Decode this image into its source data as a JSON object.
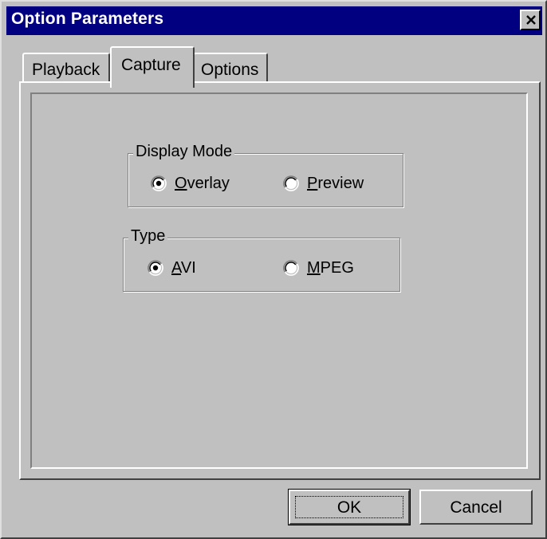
{
  "window": {
    "title": "Option Parameters"
  },
  "tabs": [
    {
      "label": "Playback",
      "selected": false
    },
    {
      "label": "Capture",
      "selected": true
    },
    {
      "label": "Options",
      "selected": false
    }
  ],
  "display_mode": {
    "legend": "Display Mode",
    "options": [
      {
        "mnemonic": "O",
        "rest": "verlay",
        "checked": true
      },
      {
        "mnemonic": "P",
        "rest": "review",
        "checked": false
      }
    ]
  },
  "type": {
    "legend": "Type",
    "options": [
      {
        "mnemonic": "A",
        "rest": "VI",
        "checked": true
      },
      {
        "mnemonic": "M",
        "rest": "PEG",
        "checked": false
      }
    ]
  },
  "buttons": {
    "ok": "OK",
    "cancel": "Cancel"
  },
  "colors": {
    "titlebar": "#000080",
    "face": "#c0c0c0"
  },
  "icons": {
    "close": "close-icon"
  }
}
